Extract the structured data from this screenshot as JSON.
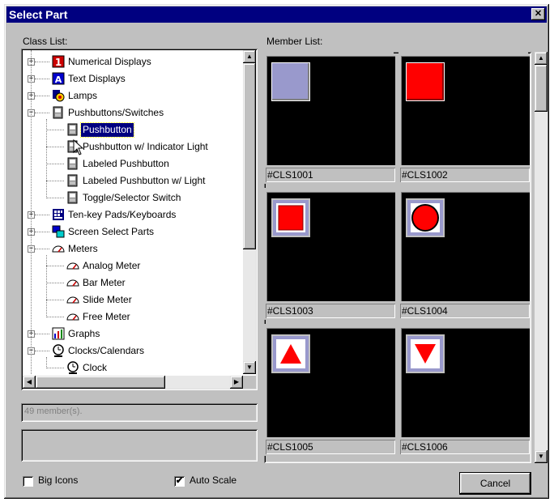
{
  "window": {
    "title": "Select Part",
    "close_glyph": "✕"
  },
  "class_list": {
    "label": "Class List:",
    "items": [
      {
        "label": "Numerical Displays",
        "icon": "numerical-display-icon",
        "level": 0,
        "expander": "+"
      },
      {
        "label": "Text Displays",
        "icon": "text-display-icon",
        "level": 0,
        "expander": "+"
      },
      {
        "label": "Lamps",
        "icon": "lamp-icon",
        "level": 0,
        "expander": "+"
      },
      {
        "label": "Pushbuttons/Switches",
        "icon": "pushbutton-icon",
        "level": 0,
        "expander": "−"
      },
      {
        "label": "Pushbutton",
        "icon": "pushbutton-icon",
        "level": 1,
        "selected": true
      },
      {
        "label": "Pushbutton w/ Indicator Light",
        "icon": "pushbutton-icon",
        "level": 1
      },
      {
        "label": "Labeled Pushbutton",
        "icon": "pushbutton-icon",
        "level": 1
      },
      {
        "label": "Labeled Pushbutton w/ Light",
        "icon": "pushbutton-icon",
        "level": 1
      },
      {
        "label": "Toggle/Selector Switch",
        "icon": "pushbutton-icon",
        "level": 1
      },
      {
        "label": "Ten-key Pads/Keyboards",
        "icon": "keypad-icon",
        "level": 0,
        "expander": "+"
      },
      {
        "label": "Screen Select Parts",
        "icon": "screen-select-icon",
        "level": 0,
        "expander": "+"
      },
      {
        "label": "Meters",
        "icon": "meter-icon",
        "level": 0,
        "expander": "−"
      },
      {
        "label": "Analog Meter",
        "icon": "meter-icon",
        "level": 1
      },
      {
        "label": "Bar Meter",
        "icon": "meter-icon",
        "level": 1
      },
      {
        "label": "Slide Meter",
        "icon": "meter-icon",
        "level": 1
      },
      {
        "label": "Free Meter",
        "icon": "meter-icon",
        "level": 1
      },
      {
        "label": "Graphs",
        "icon": "graph-icon",
        "level": 0,
        "expander": "+"
      },
      {
        "label": "Clocks/Calendars",
        "icon": "clock-icon",
        "level": 0,
        "expander": "−"
      },
      {
        "label": "Clock",
        "icon": "clock-icon",
        "level": 1
      }
    ]
  },
  "member_list": {
    "label": "Member List:",
    "items": [
      {
        "id": "#CLS1001",
        "shape": "square-button-lavender"
      },
      {
        "id": "#CLS1002",
        "shape": "square-button-red"
      },
      {
        "id": "#CLS1003",
        "shape": "framed-red-square"
      },
      {
        "id": "#CLS1004",
        "shape": "framed-red-circle"
      },
      {
        "id": "#CLS1005",
        "shape": "framed-up-triangle"
      },
      {
        "id": "#CLS1006",
        "shape": "framed-down-triangle"
      }
    ]
  },
  "member_count": "49 member(s).",
  "options": {
    "big_icons": {
      "label": "Big Icons",
      "checked": false
    },
    "auto_scale": {
      "label": "Auto Scale",
      "checked": true
    }
  },
  "cancel_label": "Cancel",
  "colors": {
    "title_bar": "#000080",
    "face": "#c0c0c0",
    "selection": "#000080",
    "preview_bg": "#000000",
    "red": "#ff0000",
    "lavender": "#9999cc"
  }
}
